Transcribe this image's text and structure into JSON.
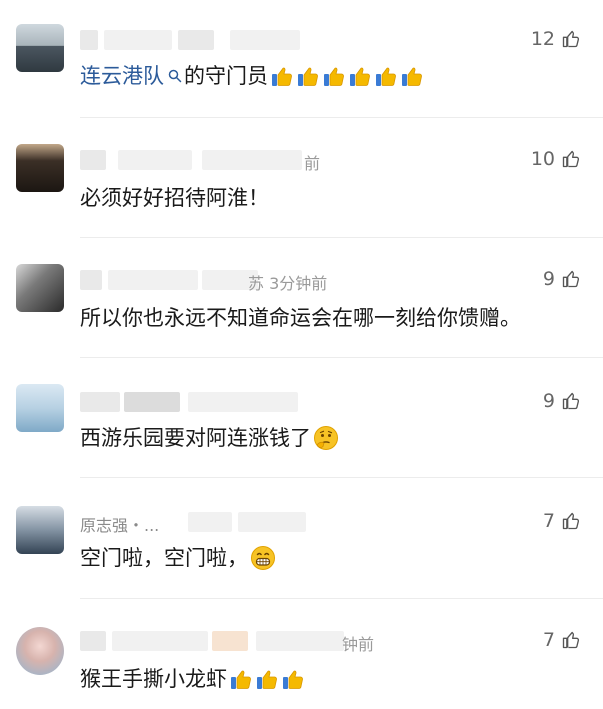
{
  "comments": [
    {
      "likes": "12",
      "text_link": "连云港队",
      "text": "的守门员",
      "emoji_count": 6
    },
    {
      "likes": "10",
      "time_tail": "前",
      "text": "必须好好招待阿淮！"
    },
    {
      "likes": "9",
      "time_tail": "苏 3分钟前",
      "text": "所以你也永远不知道命运会在哪一刻给你馈赠。"
    },
    {
      "likes": "9",
      "text": "西游乐园要对阿连涨钱了"
    },
    {
      "likes": "7",
      "name_partial": "原志强・...",
      "text": "空门啦，空门啦，"
    },
    {
      "likes": "7",
      "time_tail": "钟前",
      "text": "猴王手撕小龙虾"
    }
  ],
  "icons": {
    "like": "thumb-up-outline-icon",
    "thumbs_emoji": "thumbs-up-emoji",
    "thinking_emoji": "thinking-face-emoji",
    "grin_emoji": "grinning-face-emoji",
    "search": "search-icon"
  },
  "colors": {
    "link": "#2c5b9a",
    "text": "#1a1a1a",
    "meta": "#9a9a9a",
    "divider": "#ececec"
  }
}
